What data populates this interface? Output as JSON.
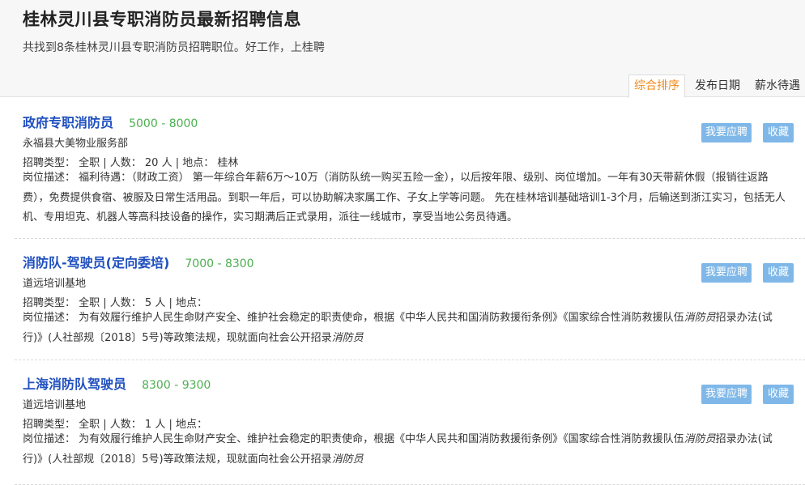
{
  "page": {
    "title": "桂林灵川县专职消防员最新招聘信息",
    "summary": "共找到8条桂林灵川县专职消防员招聘职位。好工作，上桂聘"
  },
  "sort_tabs": [
    "综合排序",
    "发布日期",
    "薪水待遇"
  ],
  "buttons": {
    "apply": "我要应聘",
    "favorite": "收藏"
  },
  "jobs": [
    {
      "title": "政府专职消防员",
      "salary": "5000 - 8000",
      "company": "永福县大美物业服务部",
      "meta": "招聘类型： 全职 | 人数： 20 人 | 地点： 桂林",
      "desc": "岗位描述： 福利待遇：（财政工资） 第一年综合年薪6万～10万（消防队统一购买五险一金），以后按年限、级别、岗位增加。一年有30天带薪休假（报销往返路费），免费提供食宿、被服及日常生活用品。到职一年后，可以协助解决家属工作、子女上学等问题。 先在桂林培训基础培训1-3个月，后输送到浙江实习，包括无人机、专用坦克、机器人等高科技设备的操作，实习期满后正式录用，派往一线城市，享受当地公务员待遇。"
    },
    {
      "title": "消防队-驾驶员(定向委培)",
      "salary": "7000 - 8300",
      "company": "道远培训基地",
      "meta": "招聘类型： 全职 | 人数： 5 人 | 地点：",
      "desc_a": "岗位描述： 为有效履行维护人民生命财产安全、维护社会稳定的职责使命，根据《中华人民共和国消防救援衔条例》《国家综合性消防救援队伍",
      "desc_em1": "消防员",
      "desc_b": "招录办法(试行)》(人社部规〔2018〕5号)等政策法规，现就面向社会公开招录",
      "desc_em2": "消防员"
    },
    {
      "title": "上海消防队驾驶员",
      "salary": "8300 - 9300",
      "company": "道远培训基地",
      "meta": "招聘类型： 全职 | 人数： 1 人 | 地点：",
      "desc_a": "岗位描述： 为有效履行维护人民生命财产安全、维护社会稳定的职责使命，根据《中华人民共和国消防救援衔条例》《国家综合性消防救援队伍",
      "desc_em1": "消防员",
      "desc_b": "招录办法(试行)》(人社部规〔2018〕5号)等政策法规，现就面向社会公开招录",
      "desc_em2": "消防员"
    }
  ]
}
